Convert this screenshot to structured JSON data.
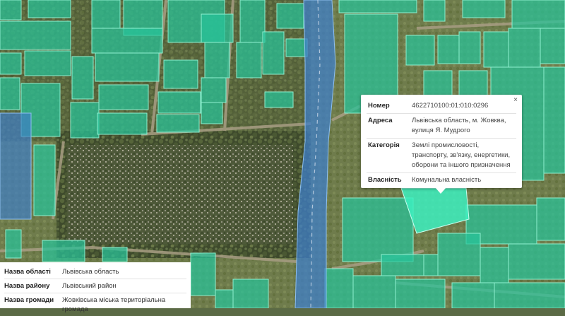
{
  "colors": {
    "parcel_fill": "#27c49a",
    "parcel_stroke": "#8ff0d0",
    "selected_parcel_fill": "#3df0c0",
    "road_fill": "#3f7fc8",
    "road_stroke": "#8fc0f0",
    "satellite_base": "#5b6a45"
  },
  "popup": {
    "close_label": "×",
    "rows": [
      {
        "key": "Номер",
        "value": "4622710100:01:010:0296"
      },
      {
        "key": "Адреса",
        "value": "Львівська область, м. Жовква, вулиця Я. Мудрого"
      },
      {
        "key": "Категорія",
        "value": "Землі промисловості, транспорту, зв'язку, енергетики, оборони та іншого призначення"
      },
      {
        "key": "Власність",
        "value": "Комунальна власність"
      }
    ]
  },
  "info_panel": {
    "rows": [
      {
        "key": "Назва області",
        "value": "Львівська область"
      },
      {
        "key": "Назва району",
        "value": "Львівський район"
      },
      {
        "key": "Назва громади",
        "value": "Жовківська міська територіальна громада"
      }
    ]
  }
}
